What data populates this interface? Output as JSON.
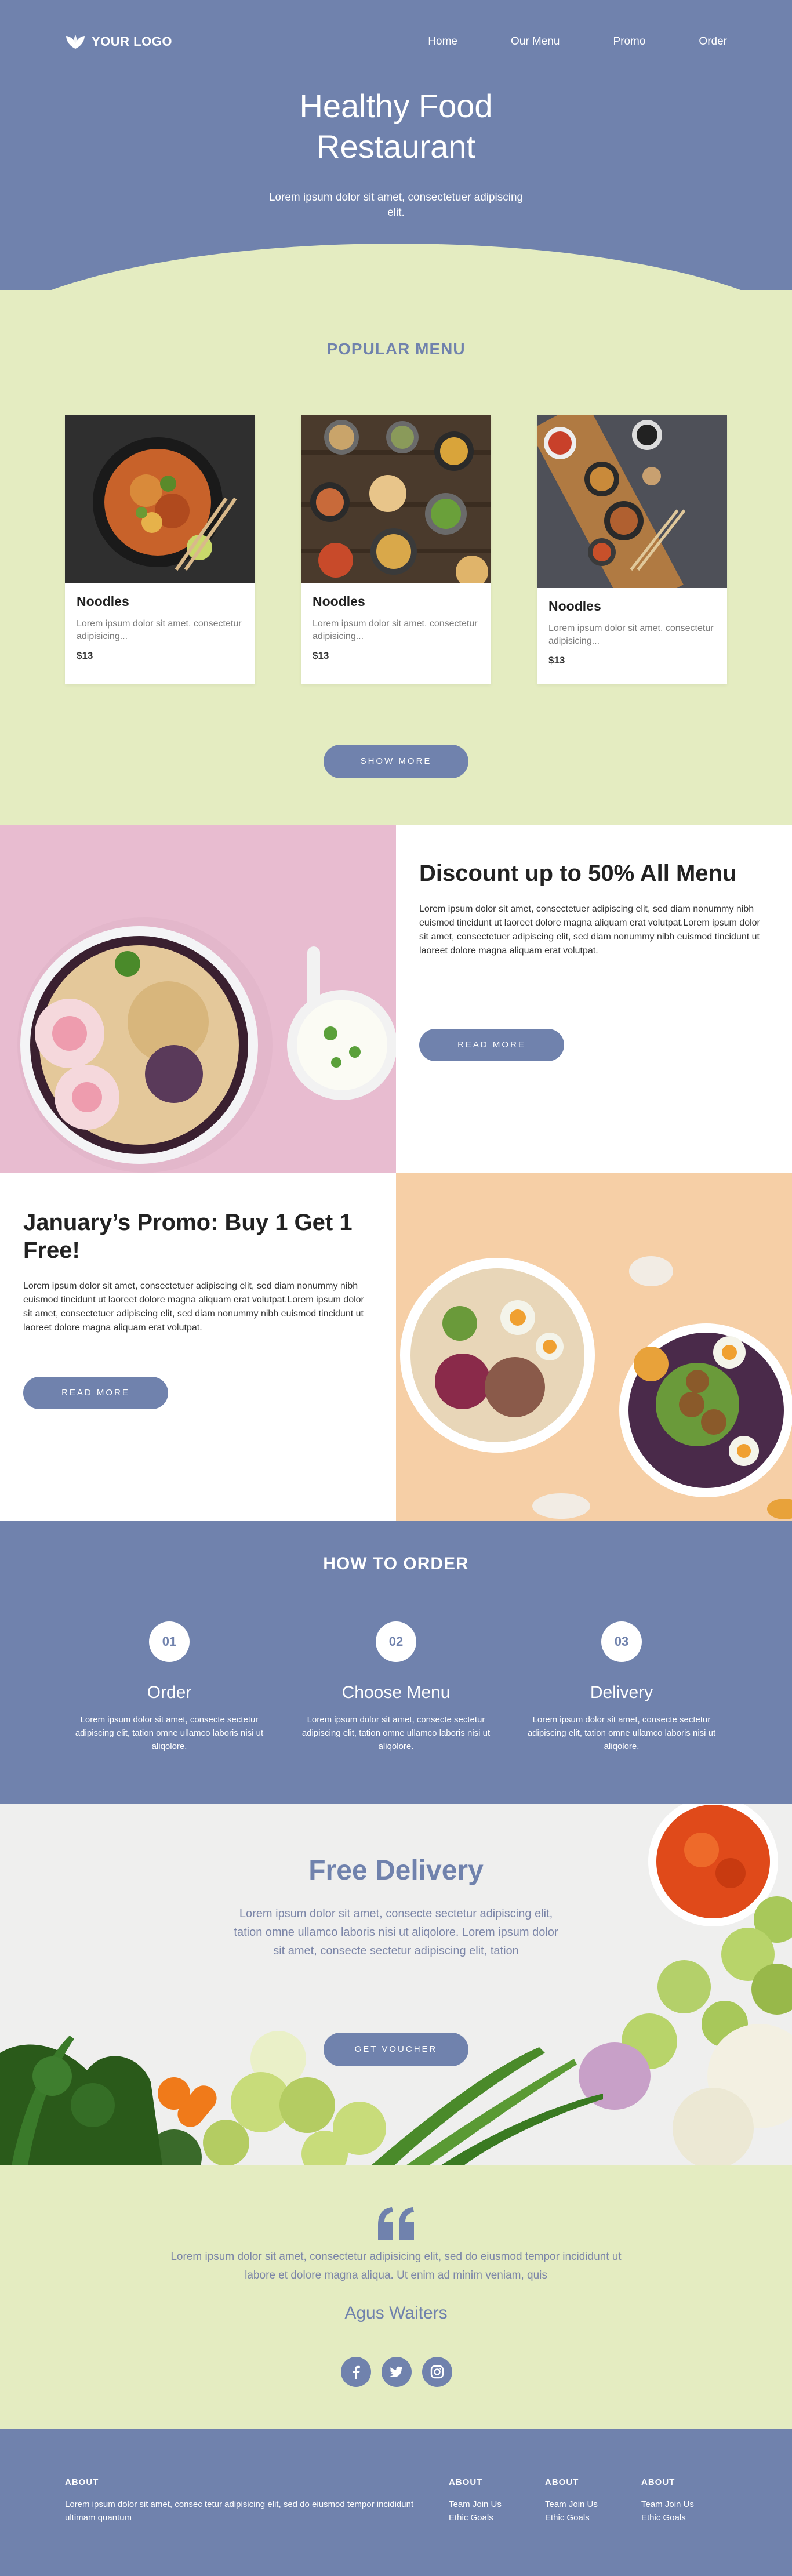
{
  "nav": {
    "logo": "YOUR LOGO",
    "items": [
      "Home",
      "Our Menu",
      "Promo",
      "Order"
    ]
  },
  "hero": {
    "title_line1": "Healthy Food",
    "title_line2": "Restaurant",
    "subtitle": "Lorem ipsum dolor sit amet, consectetuer adipiscing elit."
  },
  "popular": {
    "title": "POPULAR MENU",
    "items": [
      {
        "name": "Noodles",
        "desc": "Lorem ipsum dolor sit amet, consectetur adipisicing...",
        "price": "$13"
      },
      {
        "name": "Noodles",
        "desc": "Lorem ipsum dolor sit amet, consectetur adipisicing...",
        "price": "$13"
      },
      {
        "name": "Noodles",
        "desc": "Lorem ipsum dolor sit amet, consectetur adipisicing...",
        "price": "$13"
      }
    ],
    "show_more": "SHOW MORE"
  },
  "promo1": {
    "title": "Discount up to 50% All Menu",
    "body": "Lorem ipsum dolor sit amet, consectetuer adipiscing elit, sed diam nonummy nibh euismod tincidunt ut laoreet dolore magna aliquam erat volutpat.Lorem ipsum dolor sit amet, consectetuer adipiscing elit, sed diam nonummy nibh euismod tincidunt ut laoreet dolore magna aliquam erat volutpat.",
    "button": "READ MORE"
  },
  "promo2": {
    "title": "January’s Promo: Buy 1 Get 1 Free!",
    "body": "Lorem ipsum dolor sit amet, consectetuer adipiscing elit, sed diam nonummy nibh euismod tincidunt ut laoreet dolore magna aliquam erat volutpat.Lorem ipsum dolor sit amet, consectetuer adipiscing elit, sed diam nonummy nibh euismod tincidunt ut laoreet dolore magna aliquam erat volutpat.",
    "button": "READ MORE"
  },
  "how": {
    "title": "HOW TO ORDER",
    "steps": [
      {
        "num": "01",
        "title": "Order",
        "desc": "Lorem ipsum dolor sit amet, consecte sectetur adipiscing elit, tation omne ullamco laboris nisi ut aliqolore."
      },
      {
        "num": "02",
        "title": "Choose Menu",
        "desc": "Lorem ipsum dolor sit amet, consecte sectetur adipiscing elit, tation omne ullamco laboris nisi ut aliqolore."
      },
      {
        "num": "03",
        "title": "Delivery",
        "desc": "Lorem ipsum dolor sit amet, consecte sectetur adipiscing elit, tation omne ullamco laboris nisi ut aliqolore."
      }
    ]
  },
  "delivery": {
    "title": "Free Delivery",
    "body": "Lorem ipsum dolor sit amet, consecte sectetur adipiscing elit, tation omne ullamco laboris nisi ut aliqolore. Lorem ipsum dolor sit amet, consecte sectetur adipiscing elit, tation",
    "button": "GET VOUCHER"
  },
  "testimonial": {
    "text": "Lorem ipsum dolor sit amet, consectetur adipisicing elit, sed do eiusmod tempor incididunt ut labore et dolore magna aliqua. Ut enim ad minim veniam, quis",
    "author": "Agus Waiters"
  },
  "footer": {
    "about_title": "ABOUT",
    "about_text": "Lorem ipsum dolor sit amet, consec tetur adipisicing elit, sed do eiusmod tempor incididunt ultimam quantum",
    "columns": [
      {
        "title": "ABOUT",
        "links": [
          "Team Join Us",
          "Ethic Goals"
        ]
      },
      {
        "title": "ABOUT",
        "links": [
          "Team Join Us",
          "Ethic Goals"
        ]
      },
      {
        "title": "ABOUT",
        "links": [
          "Team Join Us",
          "Ethic Goals"
        ]
      }
    ]
  },
  "colors": {
    "primary": "#7082ad",
    "light_green": "#e4ecc1",
    "pink": "#e8bcd0",
    "peach": "#f6cfa6"
  }
}
